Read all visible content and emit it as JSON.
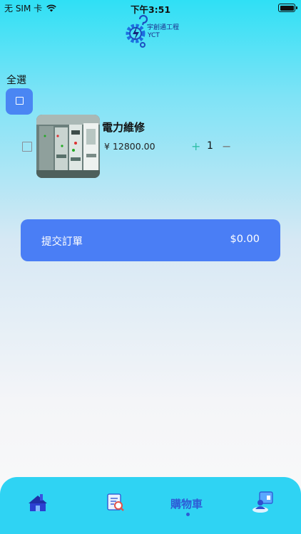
{
  "status_bar": {
    "carrier": "无 SIM 卡",
    "time": "下午3:51"
  },
  "logo": {
    "name_cn": "宇創通工程",
    "name_en": "YCT"
  },
  "cart": {
    "select_all_label": "全選",
    "items": [
      {
        "name": "電力維修",
        "price": "¥ 12800.00",
        "quantity": "1",
        "plus_glyph": "+",
        "minus_glyph": "−"
      }
    ]
  },
  "submit": {
    "label": "提交訂單",
    "total": "$0.00"
  },
  "tabbar": {
    "tabs": [
      {
        "icon": "home-icon"
      },
      {
        "icon": "search-document-icon"
      },
      {
        "label": "購物車"
      },
      {
        "icon": "profile-icon"
      }
    ],
    "active_index": 2
  },
  "colors": {
    "accent": "#4a7ef5",
    "tabbar": "#2fd3f3",
    "active_tab": "#2e5bd6"
  }
}
